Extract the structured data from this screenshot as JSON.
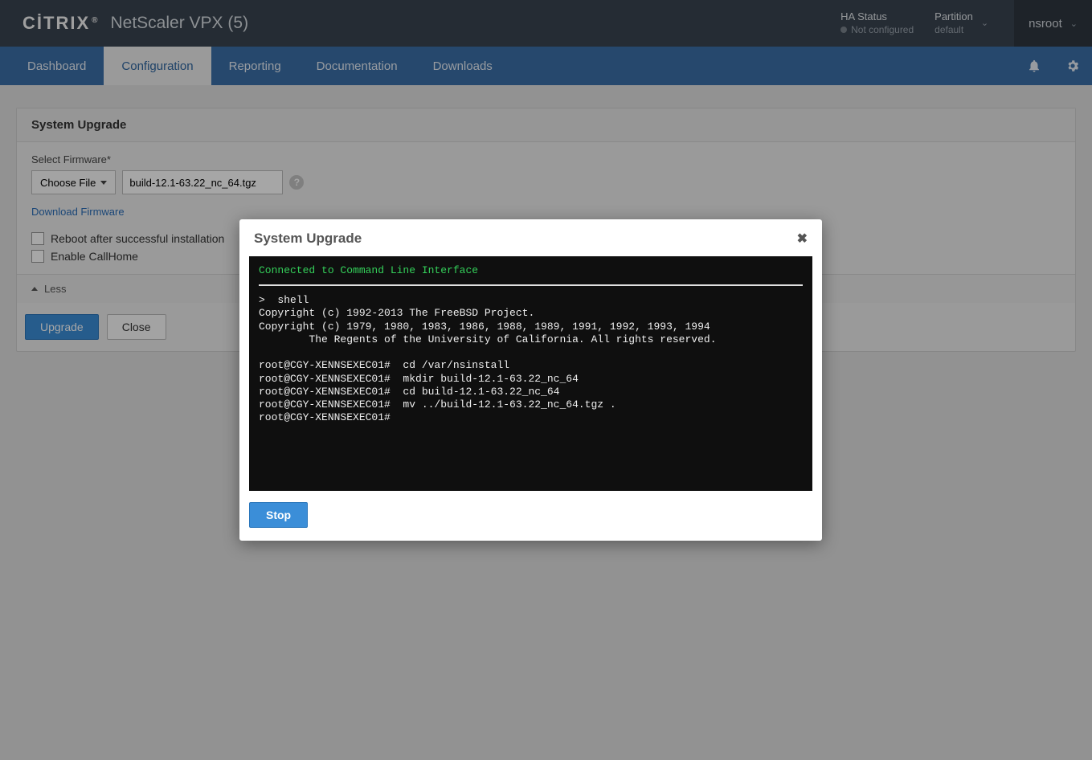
{
  "header": {
    "logo_text": "CİTRIX",
    "product_title": "NetScaler VPX (5)",
    "ha": {
      "label": "HA Status",
      "status": "Not configured"
    },
    "partition": {
      "label": "Partition",
      "value": "default"
    },
    "user": "nsroot"
  },
  "nav": {
    "tabs": [
      "Dashboard",
      "Configuration",
      "Reporting",
      "Documentation",
      "Downloads"
    ],
    "active_index": 1
  },
  "panel": {
    "title": "System Upgrade",
    "firmware_label": "Select Firmware*",
    "choose_file_label": "Choose File",
    "file_value": "build-12.1-63.22_nc_64.tgz",
    "download_link": "Download Firmware",
    "checkboxes": [
      {
        "label": "Reboot after successful installation",
        "checked": false
      },
      {
        "label": "Enable CallHome",
        "checked": false
      }
    ],
    "less_label": "Less",
    "buttons": {
      "primary": "Upgrade",
      "secondary": "Close"
    }
  },
  "modal": {
    "title": "System Upgrade",
    "cli_header": "Connected to Command Line Interface",
    "terminal_text": ">  shell\nCopyright (c) 1992-2013 The FreeBSD Project.\nCopyright (c) 1979, 1980, 1983, 1986, 1988, 1989, 1991, 1992, 1993, 1994\n        The Regents of the University of California. All rights reserved.\n\nroot@CGY-XENNSEXEC01#  cd /var/nsinstall\nroot@CGY-XENNSEXEC01#  mkdir build-12.1-63.22_nc_64\nroot@CGY-XENNSEXEC01#  cd build-12.1-63.22_nc_64\nroot@CGY-XENNSEXEC01#  mv ../build-12.1-63.22_nc_64.tgz .\nroot@CGY-XENNSEXEC01#",
    "stop_label": "Stop"
  }
}
